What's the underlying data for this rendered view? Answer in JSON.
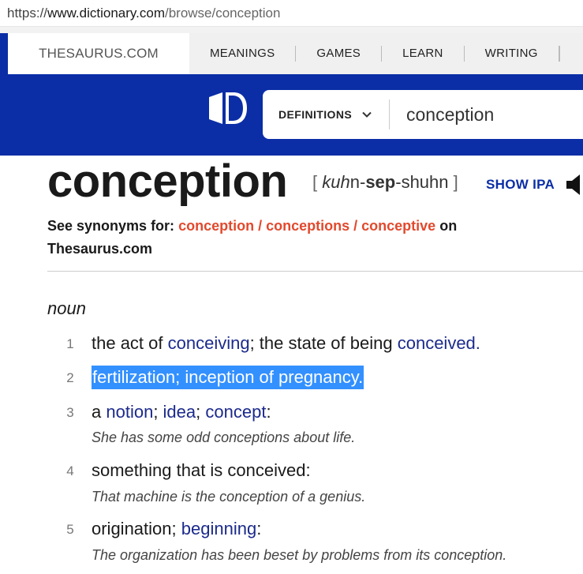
{
  "browser": {
    "url_scheme": "https://",
    "url_domain": "www.dictionary.com",
    "url_path": "/browse/conception"
  },
  "nav": {
    "thesaurus_tab": "THESAURUS.COM",
    "items": [
      "MEANINGS",
      "GAMES",
      "LEARN",
      "WRITING"
    ]
  },
  "search": {
    "mode_label": "DEFINITIONS",
    "query": "conception"
  },
  "entry": {
    "headword": "conception",
    "pron_open": "[",
    "pron_1": "kuh",
    "pron_2": "n",
    "pron_3": "-",
    "pron_4": "sep",
    "pron_5": "-",
    "pron_6": "shuhn",
    "pron_close": "]",
    "show_ipa": "SHOW IPA",
    "synonyms_prefix": "See synonyms for:",
    "synonym_links": [
      "conception",
      "conceptions",
      "conceptive"
    ],
    "synonym_sep": " / ",
    "synonyms_suffix": "on",
    "synonyms_site": "Thesaurus.com",
    "part_of_speech": "noun"
  },
  "definitions": [
    {
      "num": "1",
      "t1": "the act of ",
      "l1": "conceiving",
      "t2": "; the state of being ",
      "l2": "conceived",
      "t3": "."
    },
    {
      "num": "2",
      "highlight": "fertilization; inception of pregnancy."
    },
    {
      "num": "3",
      "t1": "a ",
      "l1": "notion",
      "t2": "; ",
      "l2": "idea",
      "t3": "; ",
      "l3": "concept",
      "t4": ":",
      "example": "She has some odd conceptions about life."
    },
    {
      "num": "4",
      "t1": "something that is conceived:",
      "example": "That machine is the conception of a genius."
    },
    {
      "num": "5",
      "t1": "origination; ",
      "l1": "beginning",
      "t2": ":",
      "example": "The organization has been beset by problems from its conception."
    }
  ],
  "colors": {
    "brand_blue": "#0b2ea6",
    "link_red": "#e2492d",
    "link_blue": "#1b2a8c",
    "selection": "#3390ff"
  }
}
